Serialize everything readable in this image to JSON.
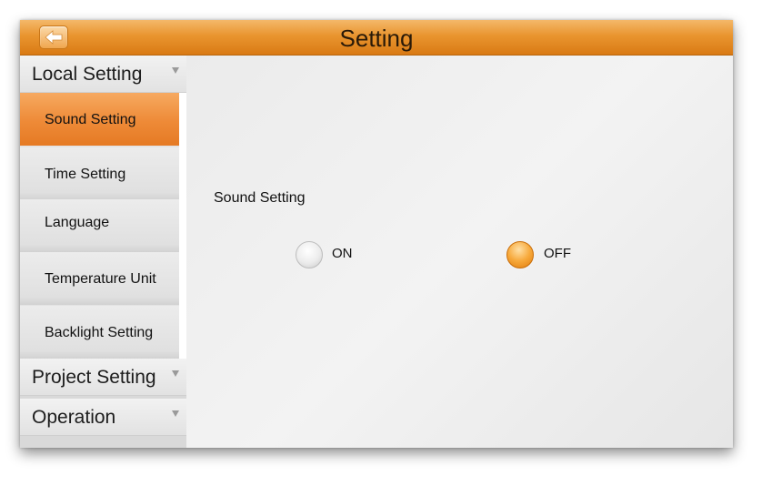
{
  "header": {
    "title": "Setting",
    "back_icon": "back-arrow-icon",
    "accent_color": "#e9952f"
  },
  "sidebar": {
    "sections": [
      {
        "label": "Local Setting",
        "expanded": true
      },
      {
        "label": "Project Setting",
        "expanded": false
      },
      {
        "label": "Operation",
        "expanded": false
      }
    ],
    "local_items": [
      {
        "label": "Sound Setting",
        "active": true
      },
      {
        "label": "Time Setting",
        "active": false
      },
      {
        "label": "Language",
        "active": false
      },
      {
        "label": "Temperature Unit",
        "active": false
      },
      {
        "label": "Backlight Setting",
        "active": false
      }
    ]
  },
  "main": {
    "heading": "Sound Setting",
    "options": [
      {
        "label": "ON",
        "selected": false
      },
      {
        "label": "OFF",
        "selected": true
      }
    ]
  }
}
